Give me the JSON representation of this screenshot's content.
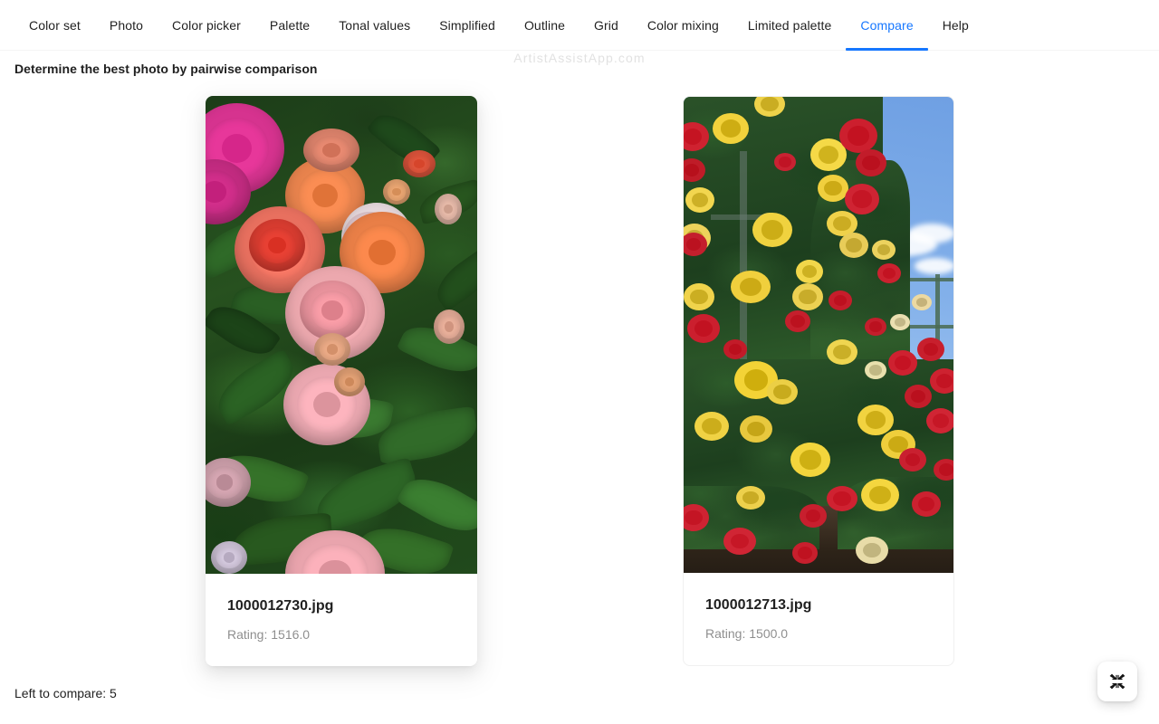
{
  "nav": {
    "items": [
      {
        "label": "Color set",
        "active": false
      },
      {
        "label": "Photo",
        "active": false
      },
      {
        "label": "Color picker",
        "active": false
      },
      {
        "label": "Palette",
        "active": false
      },
      {
        "label": "Tonal values",
        "active": false
      },
      {
        "label": "Simplified",
        "active": false
      },
      {
        "label": "Outline",
        "active": false
      },
      {
        "label": "Grid",
        "active": false
      },
      {
        "label": "Color mixing",
        "active": false
      },
      {
        "label": "Limited palette",
        "active": false
      },
      {
        "label": "Compare",
        "active": true
      },
      {
        "label": "Help",
        "active": false
      }
    ],
    "active_color": "#1677ff"
  },
  "watermark": {
    "text": "ArtistAssistApp.com",
    "color": "#e2e2e2"
  },
  "page": {
    "subtitle": "Determine the best photo by pairwise comparison",
    "status": "Left to compare: 5"
  },
  "cards": [
    {
      "side": "left",
      "title": "1000012730.jpg",
      "rating": "Rating: 1516.0",
      "photo_description": "Close-up of pink, coral and orange garden roses surrounded by dark green glossy foliage",
      "hovered": true
    },
    {
      "side": "right",
      "title": "1000012713.jpg",
      "rating": "Rating: 1500.0",
      "photo_description": "Rose garden with yellow and red climbing roses on a metal trellis against a blue sky with clouds",
      "hovered": false
    }
  ],
  "fab": {
    "name": "compress",
    "label": "Exit fullscreen",
    "icon": "compress-arrows-icon"
  }
}
